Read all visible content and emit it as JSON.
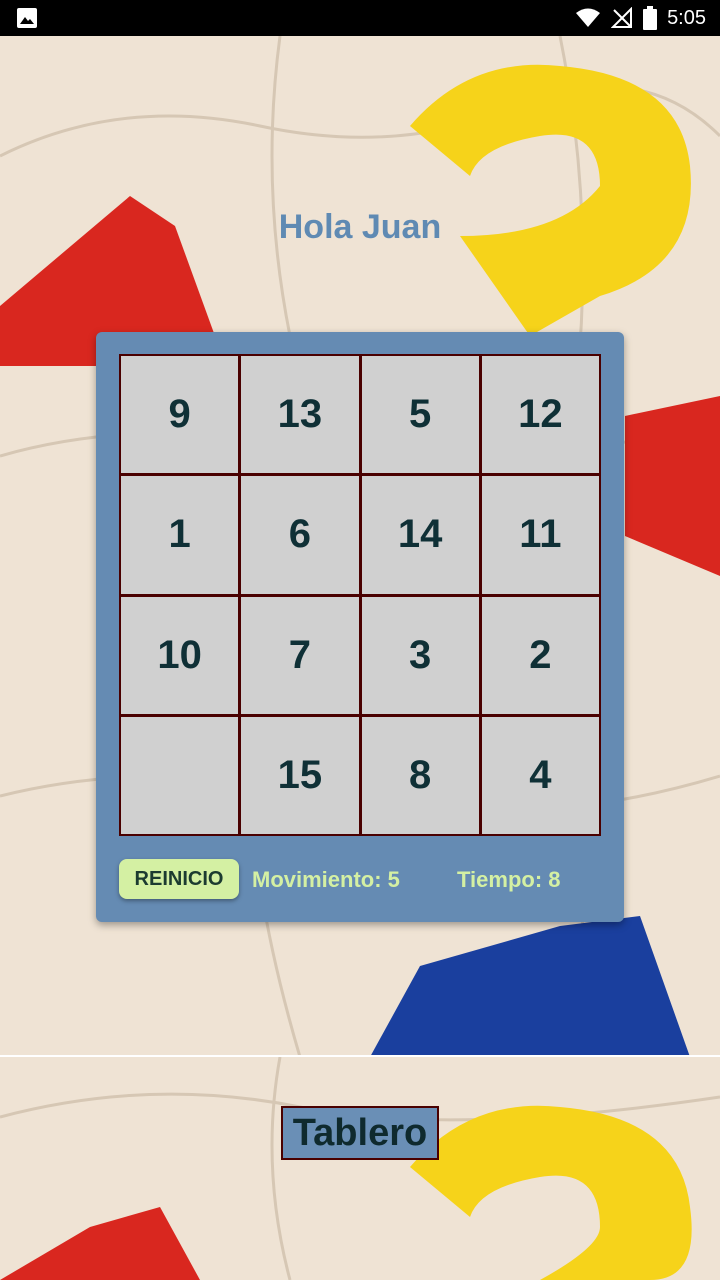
{
  "status_bar": {
    "time": "5:05",
    "icons": [
      "image-notification-icon",
      "wifi-icon",
      "no-signal-icon",
      "battery-icon"
    ]
  },
  "greeting": "Hola Juan",
  "board": {
    "tiles": [
      "9",
      "13",
      "5",
      "12",
      "1",
      "6",
      "14",
      "11",
      "10",
      "7",
      "3",
      "2",
      "",
      "15",
      "8",
      "4"
    ]
  },
  "controls": {
    "reset_label": "REINICIO",
    "moves_text": "Movimiento: 5",
    "time_text": "Tiempo: 8"
  },
  "footer": {
    "title": "Tablero"
  },
  "colors": {
    "card_bg": "#658bb3",
    "tile_bg": "#d0d0d0",
    "tile_border": "#4a0000",
    "tile_text": "#0f3036",
    "accent_green": "#d4f0a3",
    "greeting_text": "#5f8ab3"
  }
}
